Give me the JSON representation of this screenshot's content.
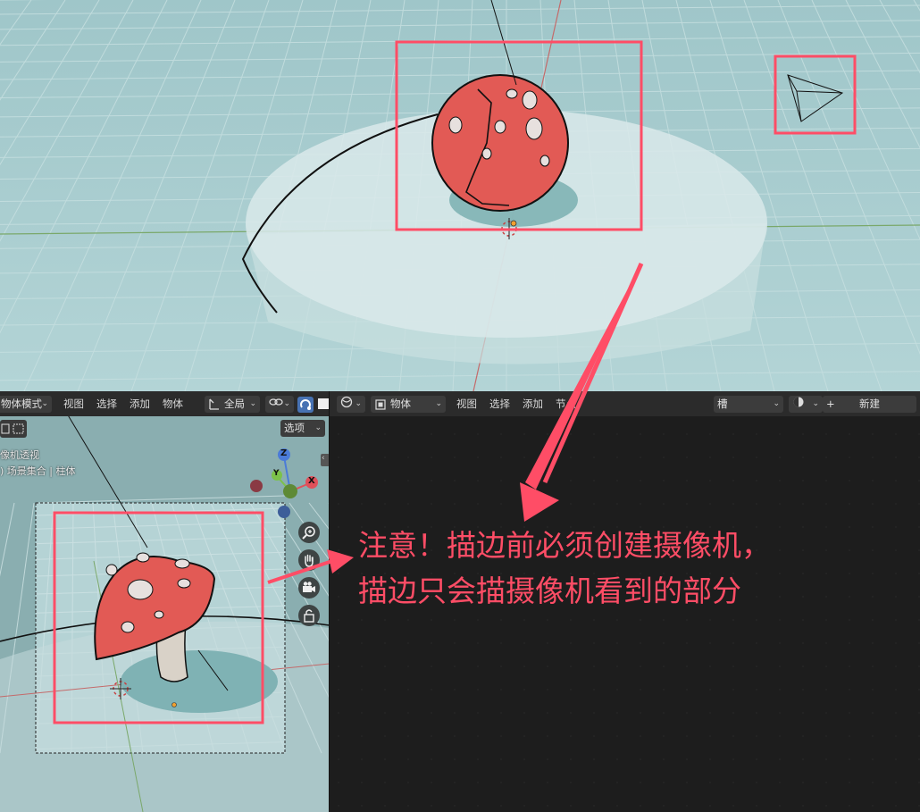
{
  "left_header": {
    "mode_dropdown": "物体模式",
    "menu": [
      "视图",
      "选择",
      "添加",
      "物体"
    ],
    "transform_dropdown": "全局",
    "options_button": "选项"
  },
  "left_overlay": {
    "view_label": "像机透视",
    "collection_label": ") 场景集合 | 柱体"
  },
  "gizmo": {
    "z": "Z",
    "y": "Y",
    "x": "X"
  },
  "right_header": {
    "object_dropdown": "物体",
    "menu": [
      "视图",
      "选择",
      "添加",
      "节点"
    ],
    "slot_dropdown": "槽",
    "new_button": "新建",
    "plus_icon": "+"
  },
  "callout": {
    "line1": "注意！描边前必须创建摄像机，",
    "line2": "描边只会描摄像机看到的部分"
  },
  "icons": {
    "zoom": "zoom-icon",
    "hand": "hand-pan-icon",
    "camera": "camera-icon",
    "lock": "lock-icon"
  },
  "colors": {
    "highlight": "#ff4d66",
    "mushroom_cap": "#e25a55",
    "viewport_bg": "#a9cdcf",
    "editor_bg": "#1d1d1d"
  }
}
